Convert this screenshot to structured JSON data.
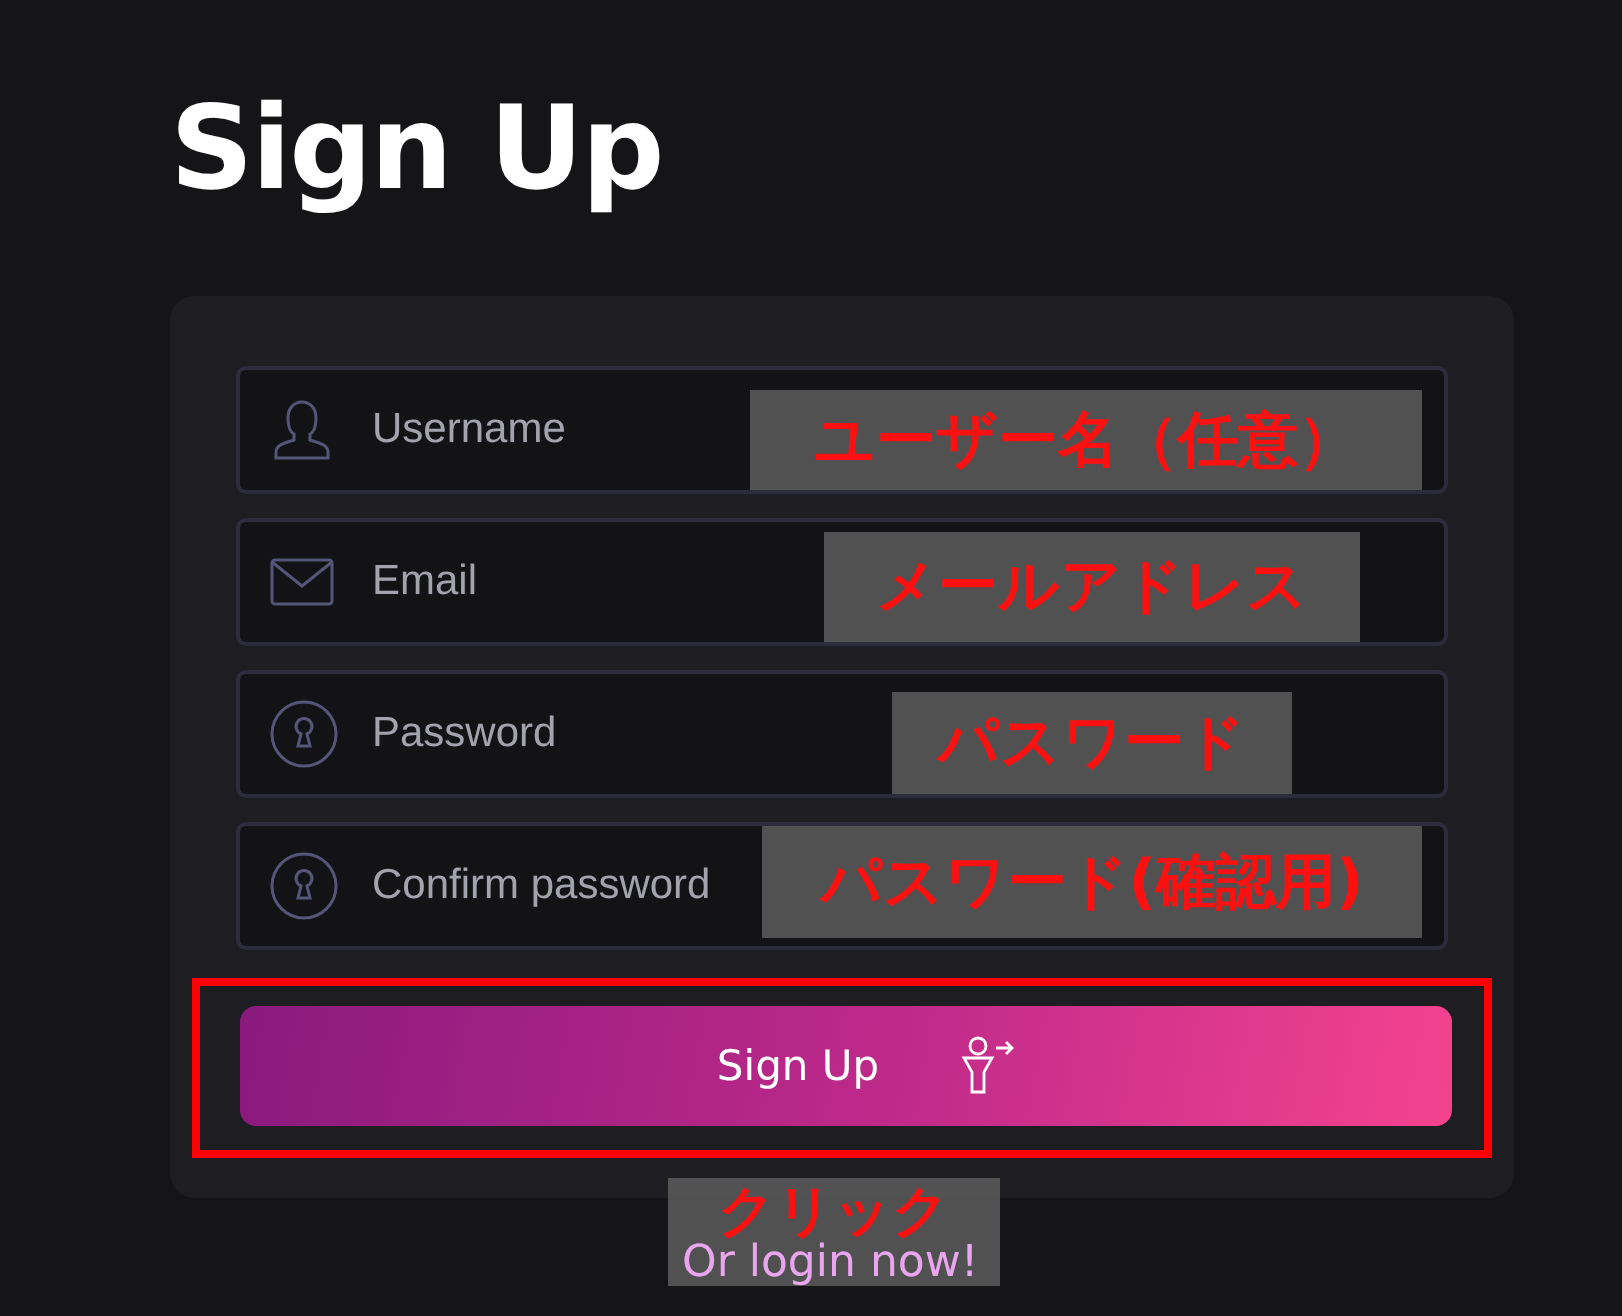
{
  "title": "Sign Up",
  "fields": [
    {
      "kind": "user",
      "placeholder": "Username"
    },
    {
      "kind": "mail",
      "placeholder": "Email"
    },
    {
      "kind": "lock",
      "placeholder": "Password"
    },
    {
      "kind": "lock",
      "placeholder": "Confirm password"
    }
  ],
  "submit": {
    "label": "Sign Up",
    "highlighted": true
  },
  "login_link": "Or login now!",
  "annotations": [
    "ユーザー名（任意）",
    "メールアドレス",
    "パスワード",
    "パスワード(確認用)",
    "クリック"
  ]
}
